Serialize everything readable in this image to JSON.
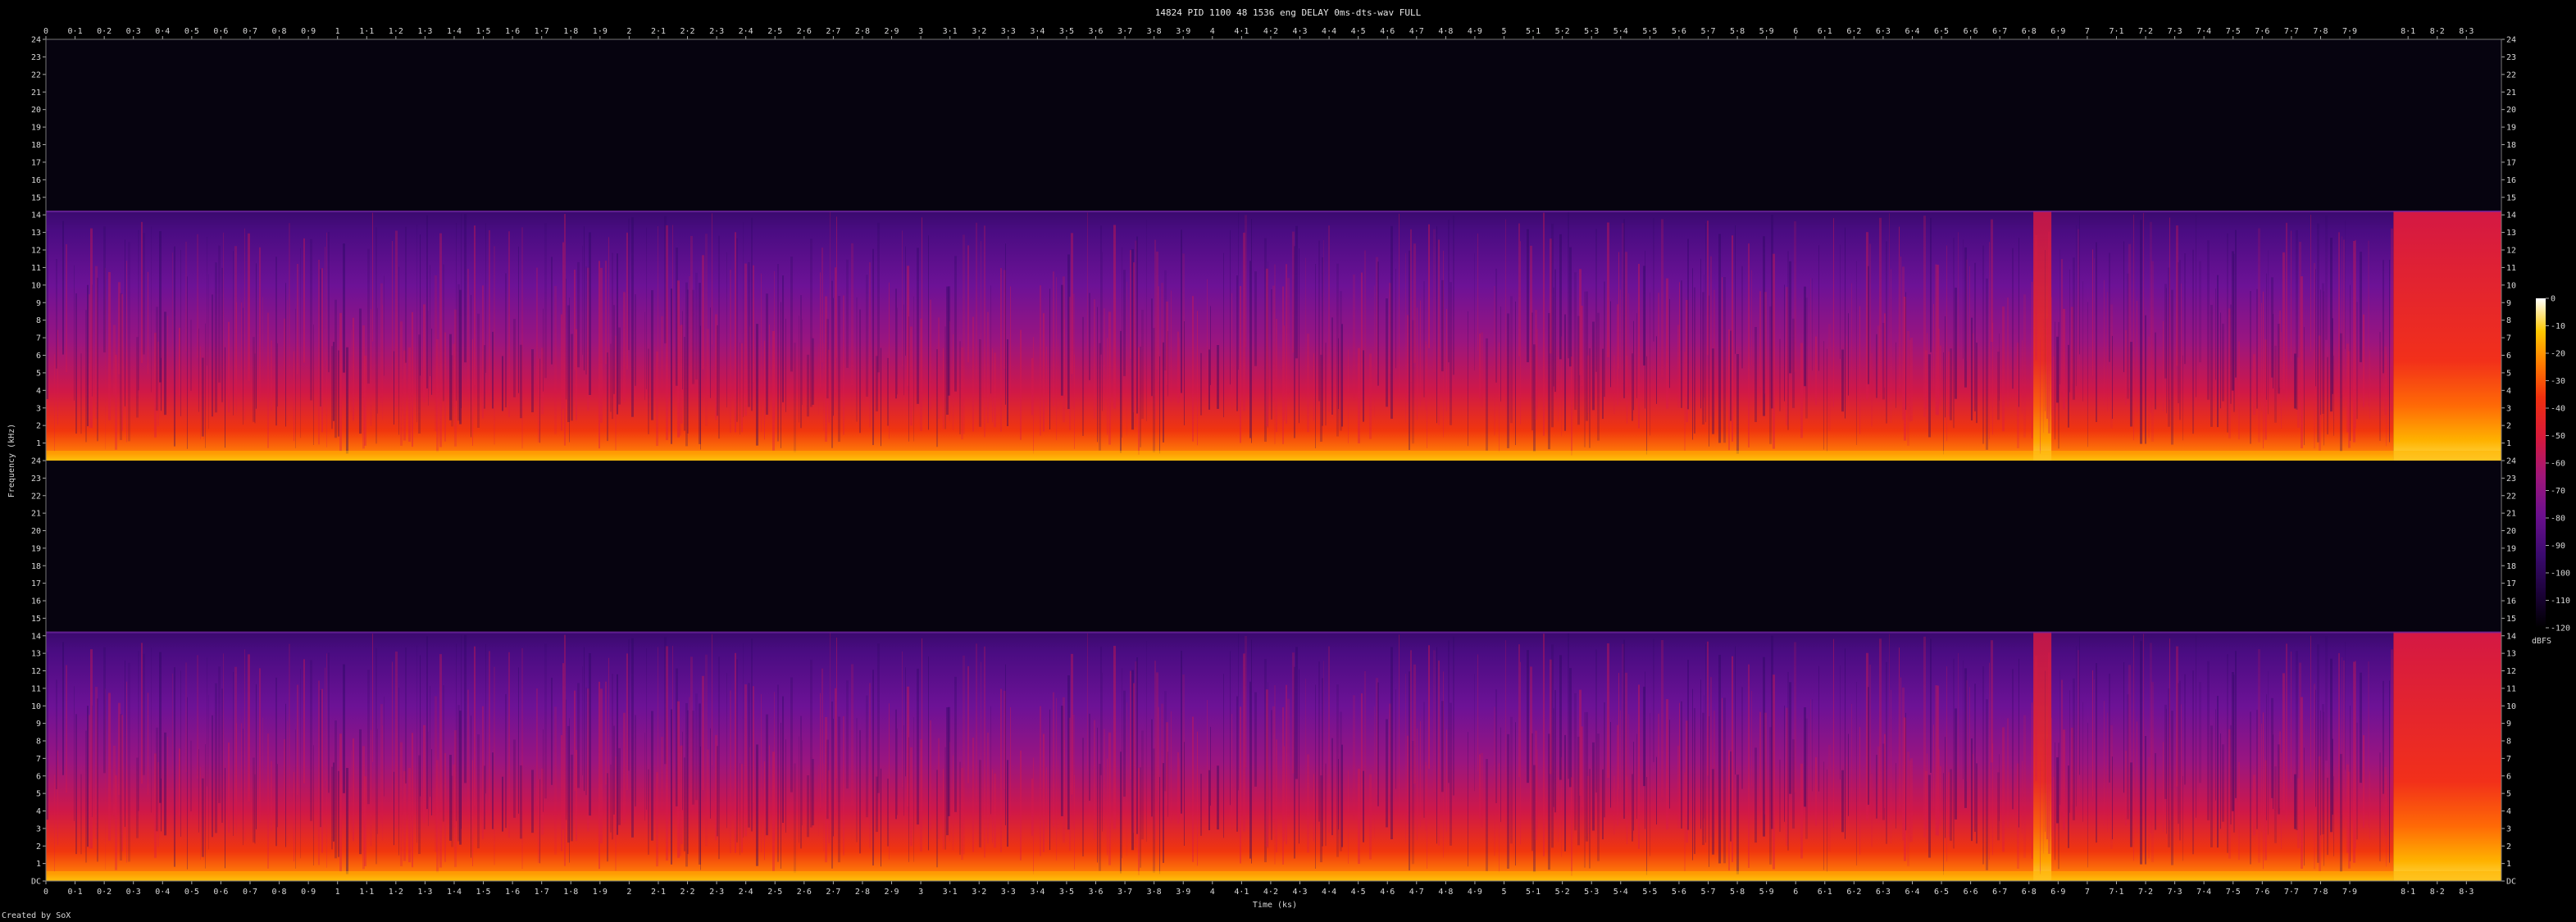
{
  "title": "14824 PID 1100 48 1536 eng DELAY 0ms-dts-wav FULL",
  "footer": "Created by SoX",
  "chart_data": {
    "type": "heatmap",
    "title": "14824 PID 1100 48 1536 eng DELAY 0ms-dts-wav FULL",
    "xlabel": "Time (ks)",
    "ylabel": "Frequency (kHz)",
    "x_ticks": [
      "0",
      "0·1",
      "0·2",
      "0·3",
      "0·4",
      "0·5",
      "0·6",
      "0·7",
      "0·8",
      "0·9",
      "1",
      "1·1",
      "1·2",
      "1·3",
      "1·4",
      "1·5",
      "1·6",
      "1·7",
      "1·8",
      "1·9",
      "2",
      "2·1",
      "2·2",
      "2·3",
      "2·4",
      "2·5",
      "2·6",
      "2·7",
      "2·8",
      "2·9",
      "3",
      "3·1",
      "3·2",
      "3·3",
      "3·4",
      "3·5",
      "3·6",
      "3·7",
      "3·8",
      "3·9",
      "4",
      "4·1",
      "4·2",
      "4·3",
      "4·4",
      "4·5",
      "4·6",
      "4·7",
      "4·8",
      "4·9",
      "5",
      "5·1",
      "5·2",
      "5·3",
      "5·4",
      "5·5",
      "5·6",
      "5·7",
      "5·8",
      "5·9",
      "6",
      "6·1",
      "6·2",
      "6·3",
      "6·4",
      "6·5",
      "6·6",
      "6·7",
      "6·8",
      "6·9",
      "7",
      "7·1",
      "7·2",
      "7·3",
      "7·4",
      "7·5",
      "7·6",
      "7·7",
      "7·8",
      "7·9",
      "8·1",
      "8·2",
      "8·3"
    ],
    "x_tick_values": [
      0,
      0.1,
      0.2,
      0.3,
      0.4,
      0.5,
      0.6,
      0.7,
      0.8,
      0.9,
      1,
      1.1,
      1.2,
      1.3,
      1.4,
      1.5,
      1.6,
      1.7,
      1.8,
      1.9,
      2,
      2.1,
      2.2,
      2.3,
      2.4,
      2.5,
      2.6,
      2.7,
      2.8,
      2.9,
      3,
      3.1,
      3.2,
      3.3,
      3.4,
      3.5,
      3.6,
      3.7,
      3.8,
      3.9,
      4,
      4.1,
      4.2,
      4.3,
      4.4,
      4.5,
      4.6,
      4.7,
      4.8,
      4.9,
      5,
      5.1,
      5.2,
      5.3,
      5.4,
      5.5,
      5.6,
      5.7,
      5.8,
      5.9,
      6,
      6.1,
      6.2,
      6.3,
      6.4,
      6.5,
      6.6,
      6.7,
      6.8,
      6.9,
      7,
      7.1,
      7.2,
      7.3,
      7.4,
      7.5,
      7.6,
      7.7,
      7.8,
      7.9,
      8.1,
      8.2,
      8.3
    ],
    "xlim": [
      0,
      8.42
    ],
    "y_ticks_top": [
      "24",
      "23",
      "22",
      "21",
      "20",
      "19",
      "18",
      "17",
      "16",
      "15",
      "14",
      "13",
      "12",
      "11",
      "10",
      "9",
      "8",
      "7",
      "6",
      "5",
      "4",
      "3",
      "2",
      "1"
    ],
    "y_ticks_bottom": [
      "24",
      "23",
      "22",
      "21",
      "20",
      "19",
      "18",
      "17",
      "16",
      "15",
      "14",
      "13",
      "12",
      "11",
      "10",
      "9",
      "8",
      "7",
      "6",
      "5",
      "4",
      "3",
      "2",
      "1",
      "DC"
    ],
    "ylim": [
      0,
      24
    ],
    "channels": 2,
    "cutoff_khz": 14.2,
    "end_segment_start_ks": 8.05,
    "gap_positions_ks": [
      6.815
    ],
    "colorbar_label": "dBFS",
    "colorbar_ticks": [
      "0",
      "-10",
      "-20",
      "-30",
      "-40",
      "-50",
      "-60",
      "-70",
      "-80",
      "-90",
      "-100",
      "-110",
      "-120"
    ],
    "colorbar_values": [
      0,
      -10,
      -20,
      -30,
      -40,
      -50,
      -60,
      -70,
      -80,
      -90,
      -100,
      -110,
      -120
    ],
    "colormap": [
      "#000000",
      "#1a0236",
      "#3a0a6e",
      "#6a0f8e",
      "#a0167a",
      "#d8193a",
      "#f0300e",
      "#ff7a00",
      "#ffc800",
      "#ffffff"
    ]
  }
}
